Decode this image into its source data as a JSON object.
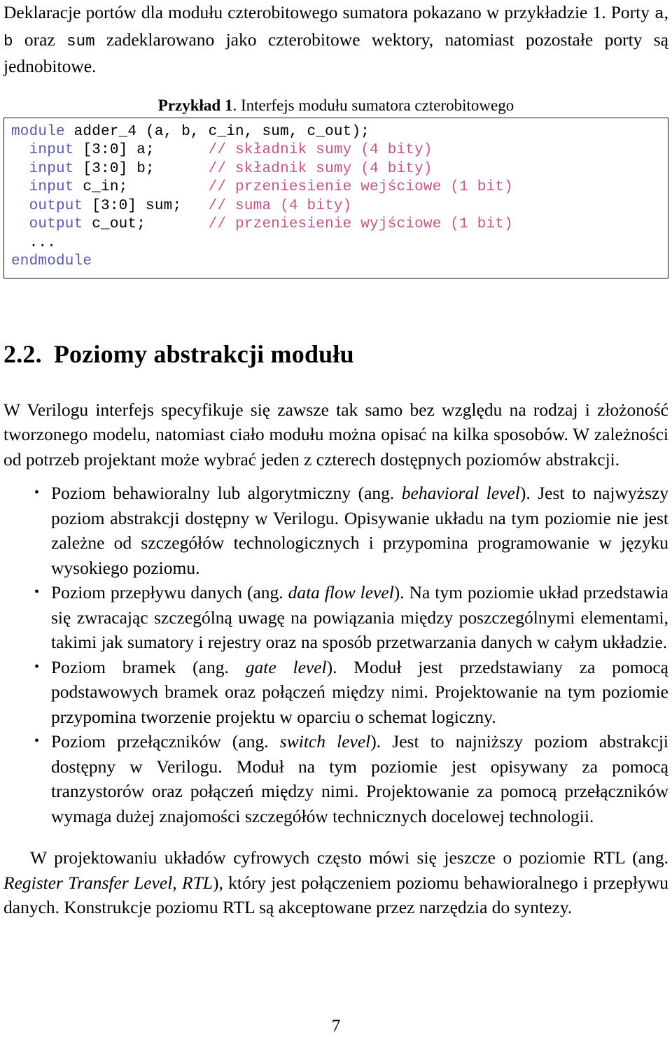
{
  "document": {
    "page_number": "7",
    "colors": {
      "keyword": "#5a5aa8",
      "comment": "#c2558a",
      "text": "#000000",
      "box_border": "#111111"
    }
  },
  "intro_paragraph": {
    "part1": "Deklaracje portów dla modułu czterobitowego sumatora pokazano w przykładzie 1. Porty ",
    "mono1": "a",
    "part2": ", ",
    "mono2": "b",
    "part3": " oraz ",
    "mono3": "sum",
    "part4": " zadeklarowano jako czterobitowe wektory, natomiast pozostałe porty są jednobitowe."
  },
  "example": {
    "caption_bold": "Przykład 1",
    "caption_rest": ". Interfejs modułu sumatora czterobitowego",
    "code_lines": [
      [
        {
          "t": "module",
          "c": "kw"
        },
        {
          "t": " adder_4 (a, b, c_in, sum, c_out);",
          "c": ""
        }
      ],
      [
        {
          "t": "  input",
          "c": "kw"
        },
        {
          "t": " [3:0] a;      ",
          "c": ""
        },
        {
          "t": "// składnik sumy (4 bity)",
          "c": "cmt"
        }
      ],
      [
        {
          "t": "  input",
          "c": "kw"
        },
        {
          "t": " [3:0] b;      ",
          "c": ""
        },
        {
          "t": "// składnik sumy (4 bity)",
          "c": "cmt"
        }
      ],
      [
        {
          "t": "  input",
          "c": "kw"
        },
        {
          "t": " c_in;         ",
          "c": ""
        },
        {
          "t": "// przeniesienie wejściowe (1 bit)",
          "c": "cmt"
        }
      ],
      [
        {
          "t": "  output",
          "c": "kw"
        },
        {
          "t": " [3:0] sum;   ",
          "c": ""
        },
        {
          "t": "// suma (4 bity)",
          "c": "cmt"
        }
      ],
      [
        {
          "t": "  output",
          "c": "kw"
        },
        {
          "t": " c_out;       ",
          "c": ""
        },
        {
          "t": "// przeniesienie wyjściowe (1 bit)",
          "c": "cmt"
        }
      ],
      [
        {
          "t": "  ...",
          "c": ""
        }
      ],
      [
        {
          "t": "endmodule",
          "c": "kw"
        }
      ]
    ]
  },
  "section": {
    "number": "2.2.",
    "title": "Poziomy abstrakcji modułu"
  },
  "section_intro": "W Verilogu interfejs specyfikuje się zawsze tak samo bez względu na rodzaj i złożoność tworzonego modelu, natomiast ciało modułu można opisać na kilka sposobów. W zależności od potrzeb projektant może wybrać jeden z czterech dostępnych poziomów abstrakcji.",
  "levels": [
    {
      "bullet": "•",
      "lead": "Poziom behawioralny lub algorytmiczny (ang. ",
      "english": "behavioral level",
      "rest": "). Jest to najwyższy poziom abstrakcji dostępny w Verilogu. Opisywanie układu na tym poziomie nie jest zależne od szczegółów technologicznych i przypomina programowanie w języku wysokiego poziomu."
    },
    {
      "bullet": "•",
      "lead": "Poziom przepływu danych (ang. ",
      "english": "data flow level",
      "rest": "). Na tym poziomie układ przedstawia się zwracając szczególną uwagę na powiązania między poszczególnymi elementami, takimi jak sumatory i rejestry oraz na sposób przetwarzania danych w całym układzie."
    },
    {
      "bullet": "•",
      "lead": "Poziom bramek (ang. ",
      "english": "gate level",
      "rest": "). Moduł jest przedstawiany za pomocą podstawowych bramek oraz połączeń między nimi. Projektowanie na tym poziomie przypomina tworzenie projektu w oparciu o schemat logiczny."
    },
    {
      "bullet": "•",
      "lead": "Poziom przełączników (ang. ",
      "english": "switch level",
      "rest": "). Jest to najniższy poziom abstrakcji dostępny w Verilogu. Moduł na tym poziomie jest opisywany za pomocą tranzystorów oraz połączeń między nimi. Projektowanie za pomocą przełączników wymaga dużej znajomości szczegółów technicznych docelowej technologii."
    }
  ],
  "closing_paragraph": {
    "part1": "W projektowaniu układów cyfrowych często mówi się jeszcze o poziomie RTL (ang. ",
    "english": "Register Transfer Level, RTL",
    "part2": "), który jest połączeniem poziomu behawioralnego i przepływu danych. Konstrukcje poziomu RTL są akceptowane przez narzędzia do syntezy."
  }
}
